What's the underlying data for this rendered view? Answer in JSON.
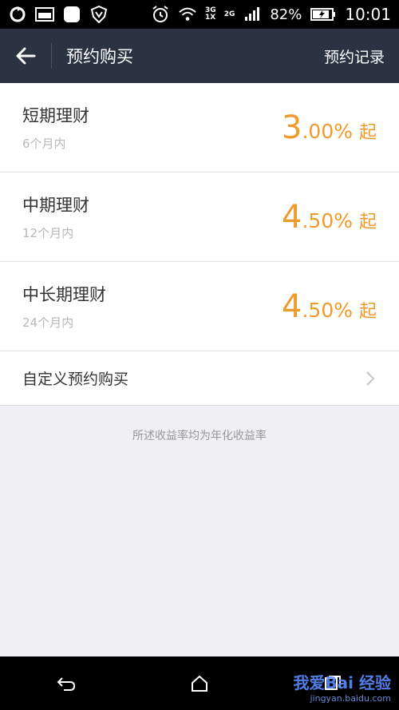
{
  "status_bar": {
    "battery": "82%",
    "time": "10:01",
    "network_3g": "3G",
    "network_1x": "1X",
    "network_2g": "2G"
  },
  "header": {
    "title": "预约购买",
    "action": "预约记录"
  },
  "items": [
    {
      "name": "短期理财",
      "term": "6个月内",
      "rate_int": "3",
      "rate_dec": ".00%",
      "suffix": "起"
    },
    {
      "name": "中期理财",
      "term": "12个月内",
      "rate_int": "4",
      "rate_dec": ".50%",
      "suffix": "起"
    },
    {
      "name": "中长期理财",
      "term": "24个月内",
      "rate_int": "4",
      "rate_dec": ".50%",
      "suffix": "起"
    }
  ],
  "custom": {
    "label": "自定义预约购买"
  },
  "note": "所述收益率均为年化收益率",
  "watermark": {
    "main": "我爱Bai 经验",
    "url": "jingyan.baidu.com"
  },
  "colors": {
    "accent": "#f09a2c",
    "header_bg": "#2b3241",
    "page_bg": "#efeff4"
  }
}
